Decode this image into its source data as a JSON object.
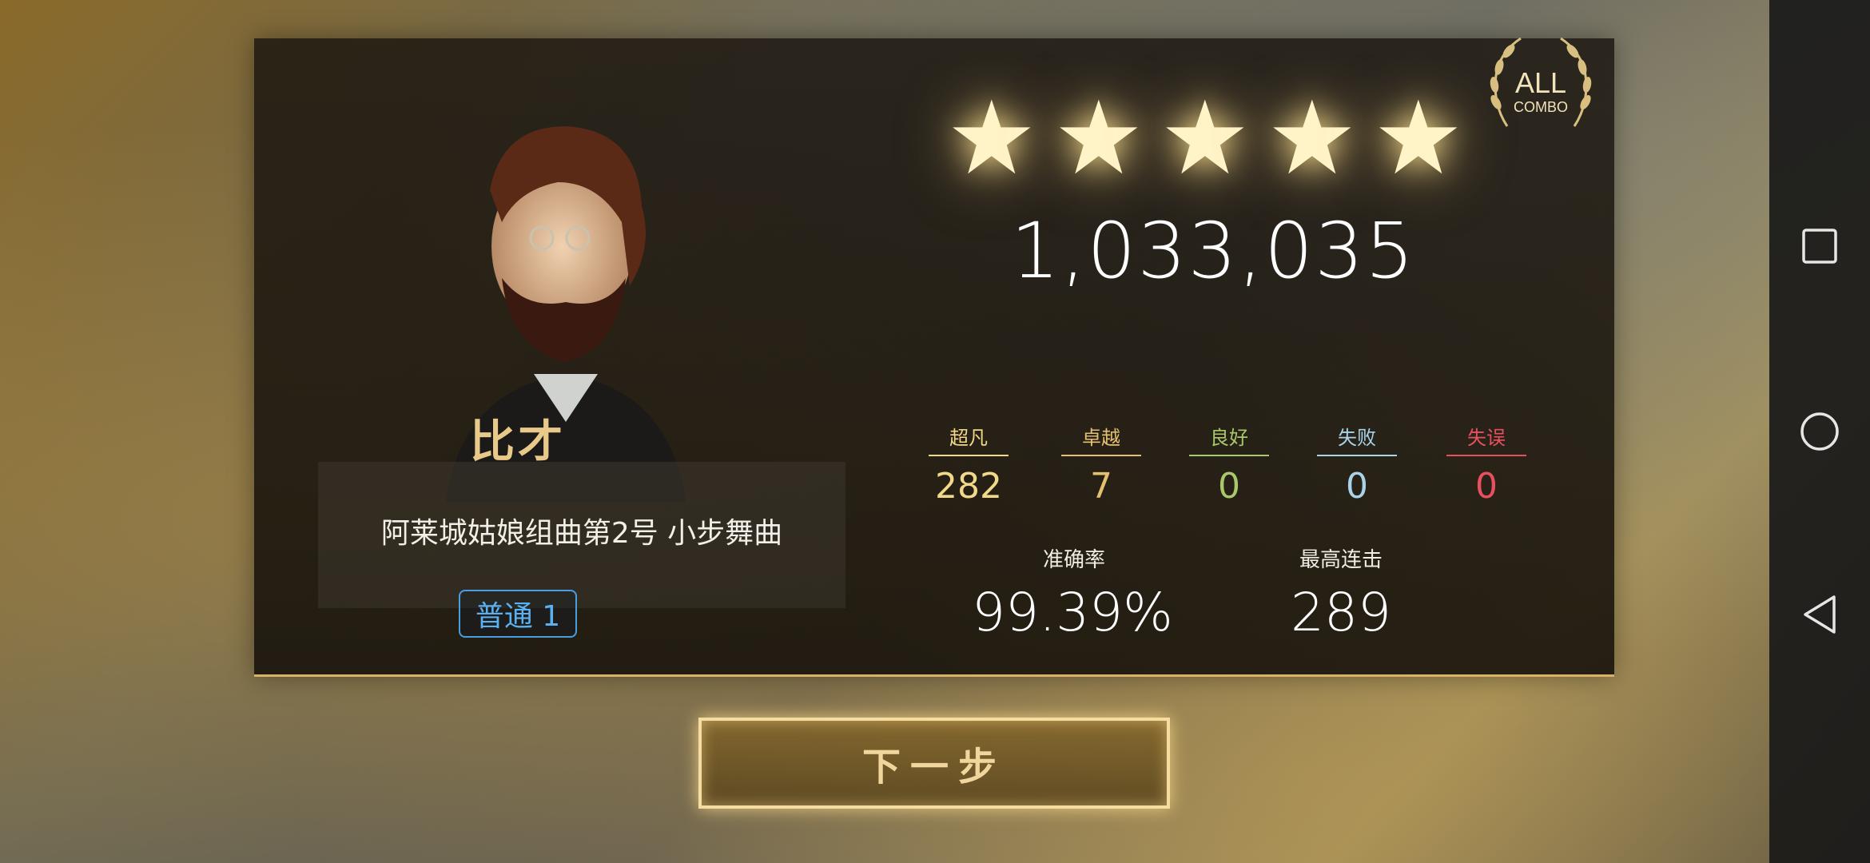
{
  "composer": {
    "name": "比才"
  },
  "song": {
    "title": "阿莱城姑娘组曲第2号 小步舞曲",
    "difficulty": "普通 1"
  },
  "result": {
    "stars": 5,
    "score": "1,033,035",
    "badge": {
      "line1": "ALL",
      "line2": "COMBO"
    },
    "judgements": [
      {
        "label": "超凡",
        "value": "282",
        "color": "#f2d98a"
      },
      {
        "label": "卓越",
        "value": "7",
        "color": "#e5c070"
      },
      {
        "label": "良好",
        "value": "0",
        "color": "#a8c86a"
      },
      {
        "label": "失败",
        "value": "0",
        "color": "#a9d3ea"
      },
      {
        "label": "失误",
        "value": "0",
        "color": "#e85060"
      }
    ],
    "accuracy_label": "准确率",
    "accuracy_value": "99.39%",
    "max_combo_label": "最高连击",
    "max_combo_value": "289"
  },
  "actions": {
    "next_label": "下一步"
  },
  "navigation": {
    "icons": [
      "square-icon",
      "circle-icon",
      "back-triangle-icon"
    ]
  },
  "colors": {
    "accent_gold": "#d9b26a",
    "difficulty_blue": "#4a9ee0"
  }
}
